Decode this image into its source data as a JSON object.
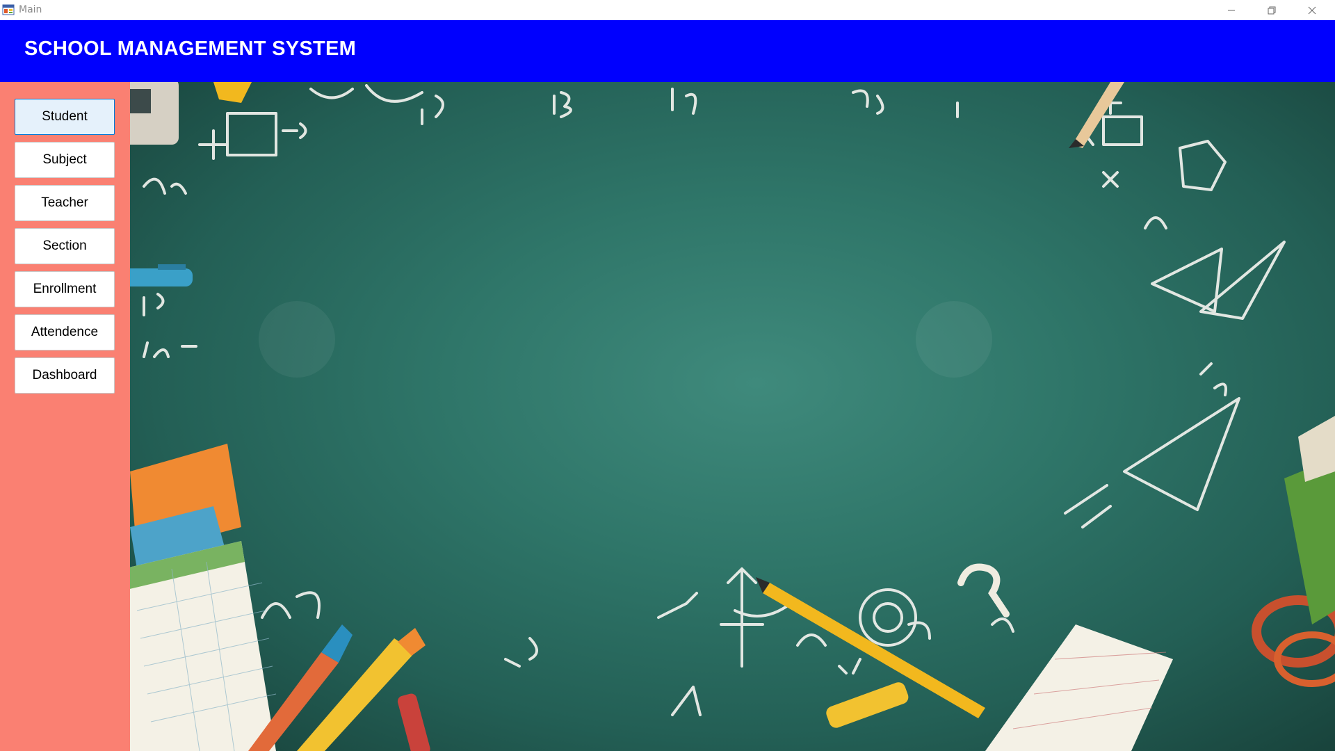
{
  "window": {
    "title": "Main",
    "icons": {
      "app": "app-window-icon",
      "minimize": "minimize-icon",
      "maximize": "restore-icon",
      "close": "close-icon"
    }
  },
  "header": {
    "title": "SCHOOL MANAGEMENT SYSTEM",
    "background_color": "#0000fe"
  },
  "sidebar": {
    "background_color": "#fa8072",
    "items": [
      {
        "label": "Student",
        "active": true
      },
      {
        "label": "Subject",
        "active": false
      },
      {
        "label": "Teacher",
        "active": false
      },
      {
        "label": "Section",
        "active": false
      },
      {
        "label": "Enrollment",
        "active": false
      },
      {
        "label": "Attendence",
        "active": false
      },
      {
        "label": "Dashboard",
        "active": false
      }
    ]
  },
  "main": {
    "background_image": "chalkboard-with-math-doodles-and-school-supplies",
    "accent_color": "#2f7669"
  }
}
